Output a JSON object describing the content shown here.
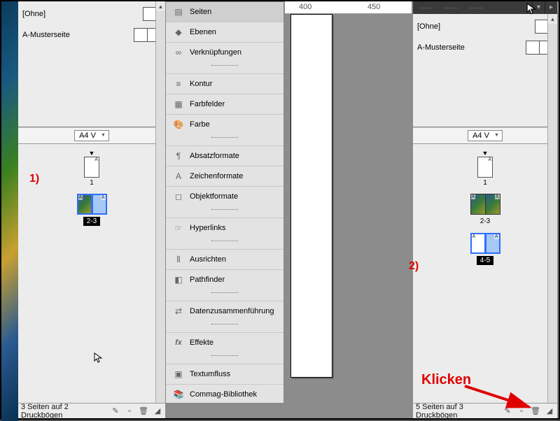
{
  "left_panel": {
    "ohne": "[Ohne]",
    "master": "A-Musterseite",
    "size": "A4 V",
    "page1_label": "1",
    "spread1_label": "2-3",
    "status": "3 Seiten auf 2 Druckbögen"
  },
  "right_panel": {
    "tab_pages_hint": "Seiten",
    "ohne": "[Ohne]",
    "master": "A-Musterseite",
    "size": "A4 V",
    "page1_label": "1",
    "spread1_label": "2-3",
    "spread2_label": "4-5",
    "status": "5 Seiten auf 3 Druckbögen"
  },
  "toolbar": {
    "seiten": "Seiten",
    "ebenen": "Ebenen",
    "verknuepfungen": "Verknüpfungen",
    "kontur": "Kontur",
    "farbfelder": "Farbfelder",
    "farbe": "Farbe",
    "absatzformate": "Absatzformate",
    "zeichenformate": "Zeichenformate",
    "objektformate": "Objektformate",
    "hyperlinks": "Hyperlinks",
    "ausrichten": "Ausrichten",
    "pathfinder": "Pathfinder",
    "datenzusammenfuehrung": "Datenzusammenführung",
    "effekte": "Effekte",
    "textumfluss": "Textumfluss",
    "commag": "Commag-Bibliothek"
  },
  "ruler": {
    "t400": "400",
    "t450": "450"
  },
  "annotations": {
    "one": "1)",
    "two": "2)",
    "klicken": "Klicken"
  },
  "master_marker": "A"
}
